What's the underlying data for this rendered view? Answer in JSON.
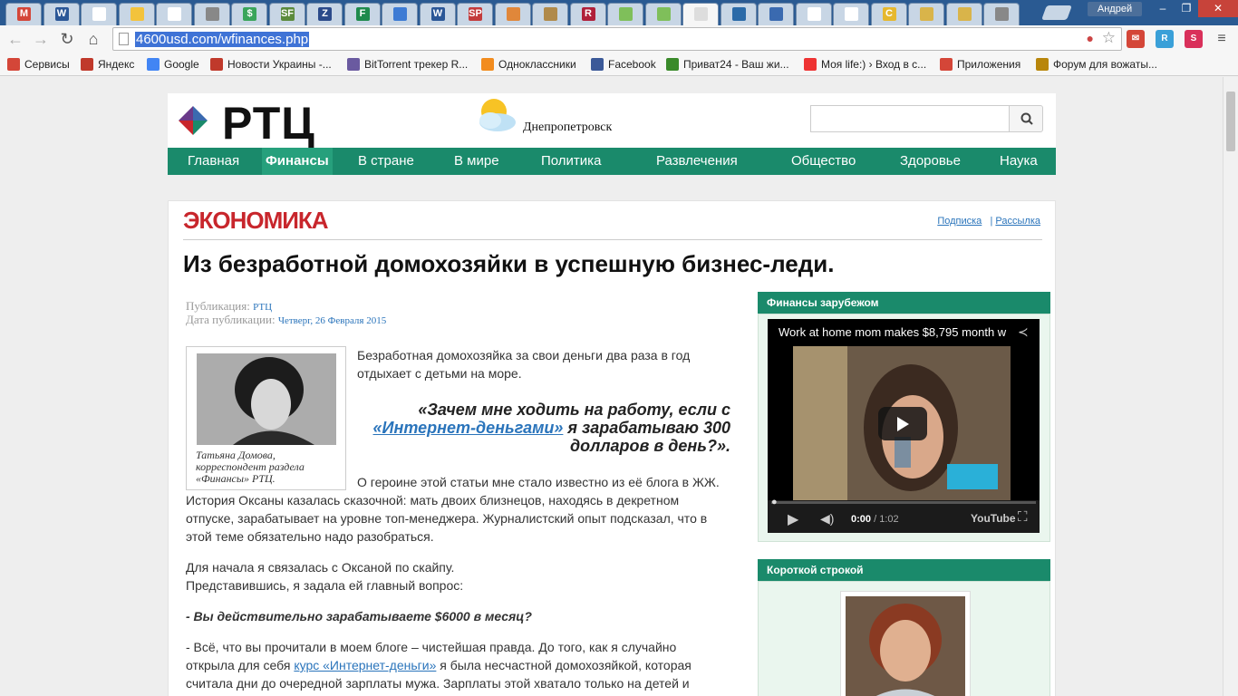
{
  "browser": {
    "user_name": "Андрей",
    "url": "4600usd.com/wfinances.php",
    "tabs": [
      {
        "icon": "gmail-icon",
        "glyph": "M",
        "color": "#d44638"
      },
      {
        "icon": "word-icon",
        "glyph": "W",
        "color": "#2b5797"
      },
      {
        "icon": "page-icon",
        "glyph": "",
        "color": "#ffffff"
      },
      {
        "icon": "bulb-icon",
        "glyph": "",
        "color": "#f3c33c"
      },
      {
        "icon": "page-icon",
        "glyph": "",
        "color": "#ffffff"
      },
      {
        "icon": "dash-icon",
        "glyph": "",
        "color": "#888888"
      },
      {
        "icon": "dollar-icon",
        "glyph": "$",
        "color": "#3aa55a"
      },
      {
        "icon": "sf-icon",
        "glyph": "SF",
        "color": "#5b8a3c"
      },
      {
        "icon": "zona-icon",
        "glyph": "Z",
        "color": "#2b4a8a"
      },
      {
        "icon": "forex-icon",
        "glyph": "F",
        "color": "#1f8a4c"
      },
      {
        "icon": "chart-icon",
        "glyph": "",
        "color": "#3d7bd4"
      },
      {
        "icon": "word-icon",
        "glyph": "W",
        "color": "#2b5797"
      },
      {
        "icon": "sp-icon",
        "glyph": "SP",
        "color": "#c33b3b"
      },
      {
        "icon": "circle-icon",
        "glyph": "",
        "color": "#e0873a"
      },
      {
        "icon": "map-icon",
        "glyph": "",
        "color": "#b08a4a"
      },
      {
        "icon": "r-icon",
        "glyph": "R",
        "color": "#b0203a"
      },
      {
        "icon": "dots-icon",
        "glyph": "",
        "color": "#7fbf5a"
      },
      {
        "icon": "dots-icon",
        "glyph": "",
        "color": "#7fbf5a"
      },
      {
        "icon": "active-tab-icon",
        "glyph": "",
        "color": "#dddddd"
      },
      {
        "icon": "rtc-icon",
        "glyph": "",
        "color": "#2a6aa8"
      },
      {
        "icon": "money-bag-icon",
        "glyph": "",
        "color": "#3a6ab0"
      },
      {
        "icon": "page-icon",
        "glyph": "",
        "color": "#ffffff"
      },
      {
        "icon": "page-icon",
        "glyph": "",
        "color": "#ffffff"
      },
      {
        "icon": "c-icon",
        "glyph": "C",
        "color": "#e6b82e"
      },
      {
        "icon": "card-icon",
        "glyph": "",
        "color": "#d9b44a"
      },
      {
        "icon": "card-icon",
        "glyph": "",
        "color": "#d9b44a"
      },
      {
        "icon": "dash-icon",
        "glyph": "",
        "color": "#888888"
      }
    ],
    "bookmarks": [
      {
        "label": "Сервисы",
        "color": "#d44638"
      },
      {
        "label": "Яндекс",
        "color": "#c0392b"
      },
      {
        "label": "Google",
        "color": "#4285f4"
      },
      {
        "label": "Новости Украины -...",
        "color": "#c0392b"
      },
      {
        "label": "BitTorrent трекер R...",
        "color": "#6a5aa0"
      },
      {
        "label": "Одноклассники",
        "color": "#f28c1e"
      },
      {
        "label": "Facebook",
        "color": "#3b5998"
      },
      {
        "label": "Приват24 - Ваш жи...",
        "color": "#3a8a2a"
      },
      {
        "label": "Моя life:) › Вход в с...",
        "color": "#e33"
      },
      {
        "label": "Приложения",
        "color": "#d44638"
      },
      {
        "label": "Форум для вожаты...",
        "color": "#b8860b"
      }
    ]
  },
  "site": {
    "logo": "РТЦ",
    "city": "Днепропетровск",
    "search_placeholder": "",
    "nav": [
      "Главная",
      "Финансы",
      "В стране",
      "В мире",
      "Политика",
      "Развлечения",
      "Общество",
      "Здоровье",
      "Наука"
    ],
    "nav_active": "Финансы"
  },
  "article": {
    "section": "ЭКОНОМИКА",
    "subscribe": "Подписка",
    "mailing": "Рассылка",
    "title": "Из безработной домохозяйки в успешную бизнес-леди.",
    "pub_label": "Публикация:",
    "pub_value": "РТЦ",
    "date_label": "Дата публикации:",
    "date_value": "Четверг, 26 Февраля 2015",
    "caption": "Татьяна Домова, корреспондент раздела «Финансы» РТЦ.",
    "intro": "Безработная домохозяйка за свои деньги два раза в год отдыхает с детьми на море.",
    "quote_pre": "«Зачем мне ходить на работу, если с",
    "quote_link": "«Интернет-деньгами»",
    "quote_post": "я зарабатываю 300 долларов в день?».",
    "p1": "О героине этой статьи мне стало известно из её блога в ЖЖ. История Оксаны казалась сказочной: мать двоих близнецов, находясь в декретном отпуске, зарабатывает на уровне топ-менеджера. Журналистский опыт подсказал, что в этой теме обязательно надо разобраться.",
    "p2a": "Для начала я связалась с Оксаной по скайпу.",
    "p2b": "Представившись, я задала ей главный вопрос:",
    "question": "- Вы действительно зарабатываете $6000 в месяц?",
    "p3_pre": "- Всё, что вы прочитали в моем блоге – чистейшая правда. До того, как я случайно открыла для себя",
    "p3_link": "курс «Интернет-деньги»",
    "p3_post": "я была несчастной домохозяйкой, которая считала дни до очередной зарплаты мужа. Зарплаты этой хватало только на детей и"
  },
  "sidebar": {
    "widget1_title": "Финансы зарубежом",
    "video_title": "Work at home mom makes $8,795 month w",
    "video_time": "0:00",
    "video_duration": "/ 1:02",
    "video_brand": "YouTube",
    "widget2_title": "Короткой строкой"
  }
}
